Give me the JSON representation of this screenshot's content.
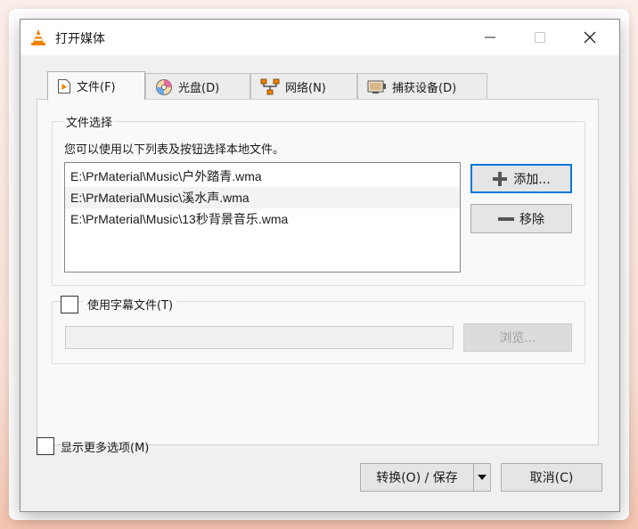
{
  "window": {
    "title": "打开媒体",
    "icon": "vlc-cone-icon"
  },
  "tabs": [
    {
      "label": "文件(F)",
      "icon": "file-play-icon",
      "active": true
    },
    {
      "label": "光盘(D)",
      "icon": "disc-icon",
      "active": false
    },
    {
      "label": "网络(N)",
      "icon": "network-icon",
      "active": false
    },
    {
      "label": "捕获设备(D)",
      "icon": "capture-device-icon",
      "active": false
    }
  ],
  "file_selection": {
    "group_title": "文件选择",
    "description": "您可以使用以下列表及按钮选择本地文件。",
    "files": [
      "E:\\PrMaterial\\Music\\户外踏青.wma",
      "E:\\PrMaterial\\Music\\溪水声.wma",
      "E:\\PrMaterial\\Music\\13秒背景音乐.wma"
    ],
    "add_label": "添加...",
    "remove_label": "移除"
  },
  "subtitle": {
    "checkbox_label": "使用字幕文件(T)",
    "checked": false,
    "path_value": "",
    "browse_label": "浏览..."
  },
  "more_options": {
    "label": "显示更多选项(M)",
    "checked": false
  },
  "footer": {
    "convert_label": "转换(O) / 保存",
    "cancel_label": "取消(C)"
  },
  "colors": {
    "accent": "#0078d7",
    "vlc_orange": "#f08200"
  }
}
